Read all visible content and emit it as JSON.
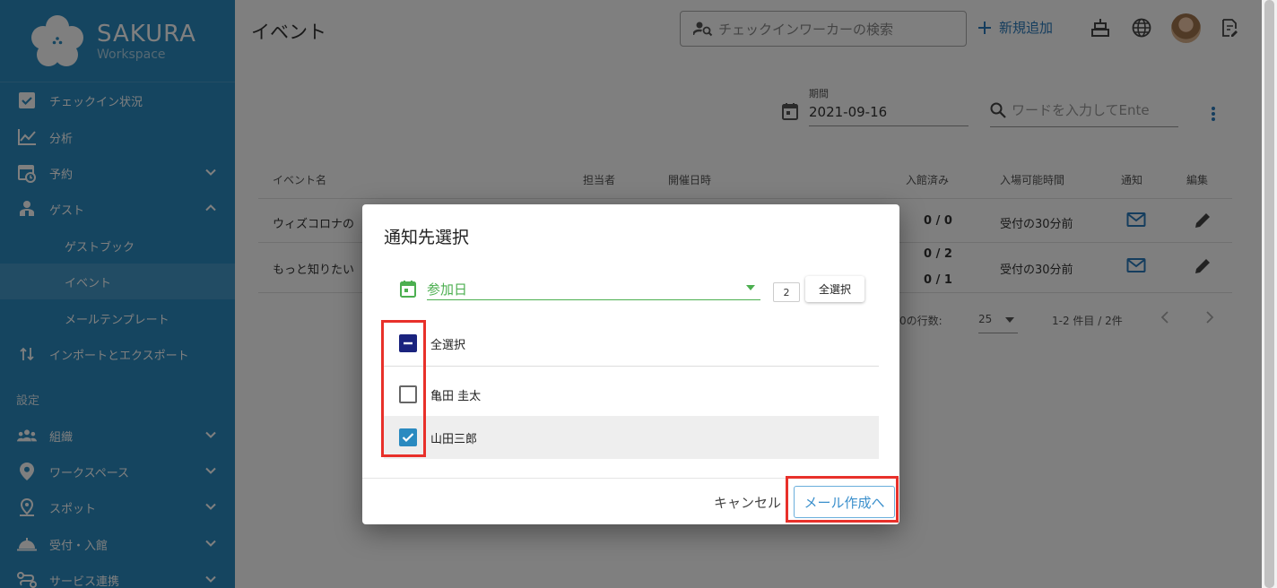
{
  "brand": {
    "name": "SAKURA",
    "sub": "Workspace"
  },
  "sidebar": {
    "items": [
      {
        "label": "チェックイン状況",
        "icon": "checkbox-icon"
      },
      {
        "label": "分析",
        "icon": "chart-line-icon"
      },
      {
        "label": "予約",
        "icon": "calendar-clock-icon"
      },
      {
        "label": "ゲスト",
        "icon": "guests-icon"
      },
      {
        "label": "ゲストブック"
      },
      {
        "label": "イベント"
      },
      {
        "label": "メールテンプレート"
      },
      {
        "label": "インポートとエクスポート",
        "icon": "import-export-icon"
      }
    ],
    "section_label": "設定",
    "settings_items": [
      {
        "label": "組織",
        "icon": "groups-icon"
      },
      {
        "label": "ワークスペース",
        "icon": "location-pin-icon"
      },
      {
        "label": "スポット",
        "icon": "spot-pin-icon"
      },
      {
        "label": "受付・入館",
        "icon": "reception-bell-icon"
      },
      {
        "label": "サービス連携",
        "icon": "service-link-icon"
      }
    ]
  },
  "header": {
    "title": "イベント",
    "search_placeholder": "チェックインワーカーの検索",
    "add_label": "新規追加"
  },
  "filters": {
    "date_label": "期間",
    "date_value": "2021-09-16",
    "word_placeholder": "ワードを入力してEnte"
  },
  "table": {
    "headers": [
      "イベント名",
      "担当者",
      "開催日時",
      "入館済み",
      "入場可能時間",
      "通知",
      "編集"
    ],
    "rows": [
      {
        "name": "ウィズコロナの",
        "checked_in": "0 / 0",
        "time": "受付の30分前"
      },
      {
        "name": "もっと知りたい",
        "checked_in": "0 / 2",
        "checked_in2": "0 / 1",
        "time": "受付の30分前"
      }
    ],
    "rows_per_page_label": "0の行数:",
    "rows_per_page": "25",
    "range": "1-2 件目 / 2件"
  },
  "dialog": {
    "title": "通知先選択",
    "select_value": "参加日",
    "count": "2",
    "select_all_button": "全選択",
    "select_all_label": "全選択",
    "people": [
      {
        "name": "亀田 圭太",
        "checked": false
      },
      {
        "name": "山田三郎",
        "checked": true
      }
    ],
    "cancel": "キャンセル",
    "compose": "メール作成へ"
  },
  "colors": {
    "sidebar": "#2a8ac0",
    "accent": "#3a8fcc",
    "green": "#4caf50",
    "checkbox_indeterminate": "#1a237e",
    "checkbox_checked": "#2a8ac0",
    "highlight": "#e8302a"
  }
}
